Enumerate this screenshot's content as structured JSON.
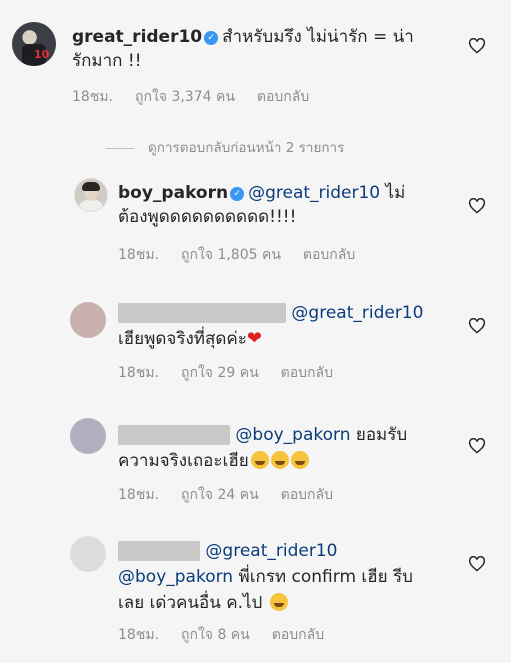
{
  "comments": [
    {
      "username": "great_rider10",
      "verified": true,
      "line1": "สำหรับมรึง ไม่น่ารัก = น่า",
      "line2": "รักมาก !!",
      "time": "18ชม.",
      "likes": "ถูกใจ 3,374 คน",
      "reply": "ตอบกลับ"
    },
    {
      "username": "boy_pakorn",
      "verified": true,
      "mention": "@great_rider10",
      "line1_tail": "ไม่",
      "line2": "ต้องพูดดดดดดดดดด!!!!",
      "time": "18ชม.",
      "likes": "ถูกใจ 1,805 คน",
      "reply": "ตอบกลับ"
    },
    {
      "mention": "@great_rider10",
      "line2": "เฮียพูดจริงที่สุดค่ะ",
      "time": "18ชม.",
      "likes": "ถูกใจ 29 คน",
      "reply": "ตอบกลับ"
    },
    {
      "mention": "@boy_pakorn",
      "line1_tail": "ยอมรับ",
      "line2": "ความจริงเถอะเฮีย",
      "time": "18ชม.",
      "likes": "ถูกใจ 24 คน",
      "reply": "ตอบกลับ"
    },
    {
      "mention": "@great_rider10",
      "mention2": "@boy_pakorn",
      "line2_tail": "พี่เกรท confirm เฮีย รีบ",
      "line3": "เลย เด่วคนอื่น ค.ไป",
      "time": "18ชม.",
      "likes": "ถูกใจ 8 คน",
      "reply": "ตอบกลับ"
    }
  ],
  "view_previous": "ดูการตอบกลับก่อนหน้า 2 รายการ",
  "icons": {
    "heart": "heart-outline-icon",
    "verified": "verified-badge-icon"
  },
  "colors": {
    "mention": "#0a3d7a",
    "verified": "#3897f0",
    "meta": "#8e8e8e"
  }
}
